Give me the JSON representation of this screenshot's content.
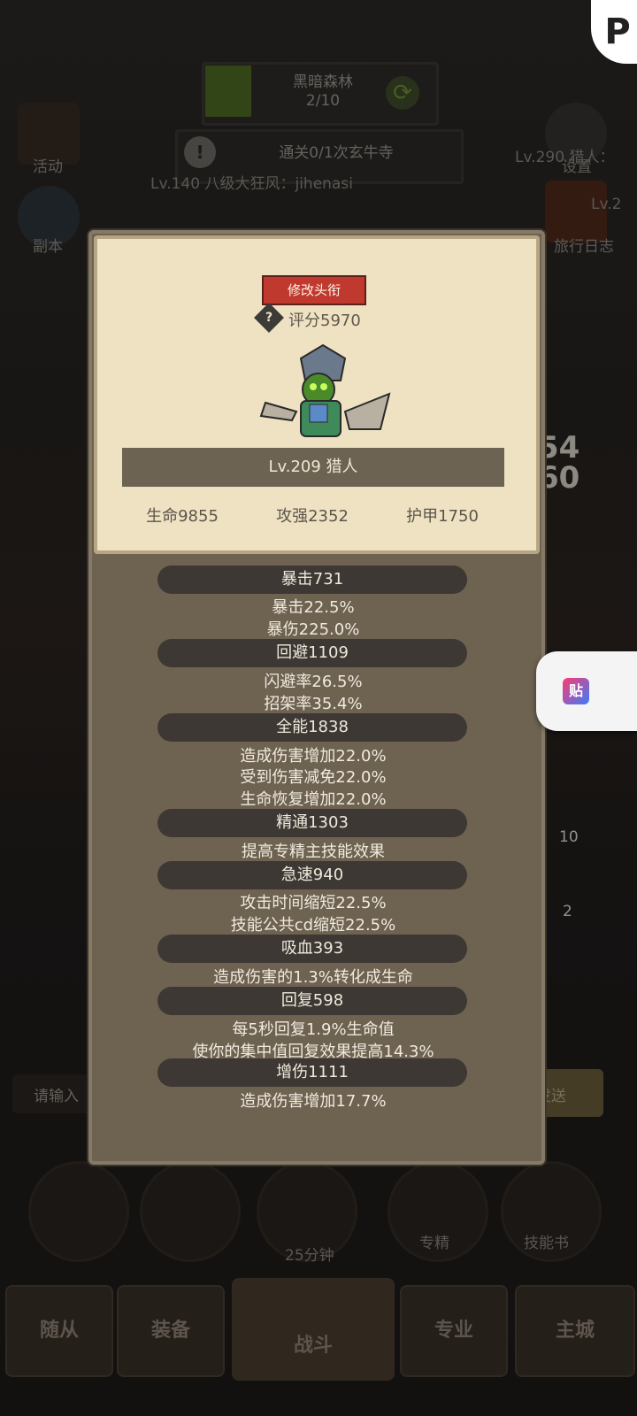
{
  "background": {
    "zone_name": "黑暗森林",
    "zone_progress": "2/10",
    "quest_text": "通关0/1次玄牛寺",
    "left_menu": [
      {
        "label": "活动"
      },
      {
        "label": "副本"
      }
    ],
    "right_menu": [
      {
        "label": "设置"
      },
      {
        "label": "旅行日志"
      }
    ],
    "player_line_left": "Lv.140 八级大狂风：jihenasi",
    "player_line_right": "Lv.290 猎人：",
    "right_level_fragment": "Lv.2",
    "right_numbers": [
      "54",
      "60"
    ],
    "side_counts": [
      "10",
      "2"
    ],
    "chat_placeholder": "请输入",
    "send_label": "发送",
    "timer_label": "25分钟",
    "skill_labels": [
      "专精",
      "技能书"
    ],
    "bottom_tabs": [
      "随从",
      "装备",
      "战斗",
      "专业",
      "主城"
    ]
  },
  "modal": {
    "rename_button": "修改头衔",
    "score_label": "评分5970",
    "character_name": "Lv.209 猎人",
    "base_stats": [
      "生命9855",
      "攻强2352",
      "护甲1750"
    ],
    "stat_sections": [
      {
        "title": "暴击731",
        "lines": [
          "暴击22.5%",
          "暴伤225.0%"
        ]
      },
      {
        "title": "回避1109",
        "lines": [
          "闪避率26.5%",
          "招架率35.4%"
        ]
      },
      {
        "title": "全能1838",
        "lines": [
          "造成伤害增加22.0%",
          "受到伤害减免22.0%",
          "生命恢复增加22.0%"
        ]
      },
      {
        "title": "精通1303",
        "lines": [
          "提高专精主技能效果"
        ]
      },
      {
        "title": "急速940",
        "lines": [
          "攻击时间缩短22.5%",
          "技能公共cd缩短22.5%"
        ]
      },
      {
        "title": "吸血393",
        "lines": [
          "造成伤害的1.3%转化成生命"
        ]
      },
      {
        "title": "回复598",
        "lines": [
          "每5秒回复1.9%生命值",
          "使你的集中值回复效果提高14.3%"
        ]
      },
      {
        "title": "增伤1111",
        "lines": [
          "造成伤害增加17.7%"
        ]
      }
    ]
  },
  "overlay": {
    "paste_label": "贴"
  },
  "colors": {
    "rename_button_bg": "#c0392f",
    "card_bg": "#efe2c3",
    "modal_bg": "#6e6251",
    "pill_bg": "#3d3833"
  }
}
